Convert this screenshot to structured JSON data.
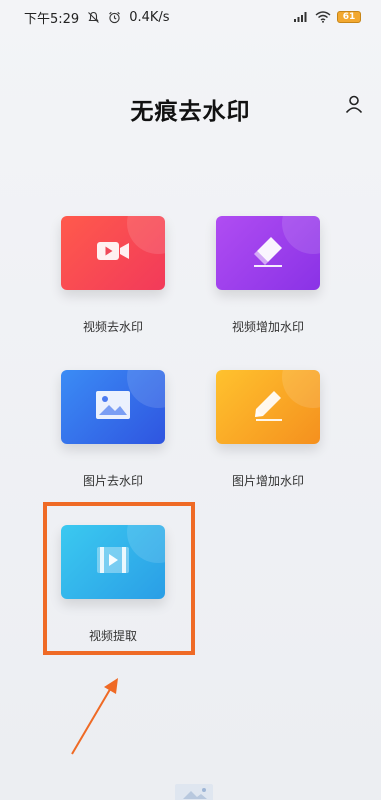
{
  "status_bar": {
    "time": "下午5:29",
    "speed": "0.4K/s",
    "battery": "61",
    "icons": [
      "mute-icon",
      "alarm-icon",
      "signal-icon",
      "wifi-icon",
      "battery-icon"
    ]
  },
  "header": {
    "title": "无痕去水印",
    "profile_icon": "user-icon"
  },
  "tiles": [
    {
      "label": "视频去水印",
      "icon": "video-camera-icon",
      "color": "#f5454f"
    },
    {
      "label": "视频增加水印",
      "icon": "eraser-icon",
      "color": "#9b3fec"
    },
    {
      "label": "图片去水印",
      "icon": "image-icon",
      "color": "#3370ea"
    },
    {
      "label": "图片增加水印",
      "icon": "pencil-icon",
      "color": "#f8a826"
    },
    {
      "label": "视频提取",
      "icon": "video-frame-icon",
      "color": "#31b3eb"
    }
  ],
  "annotation": {
    "highlight_color": "#ef6a25"
  }
}
